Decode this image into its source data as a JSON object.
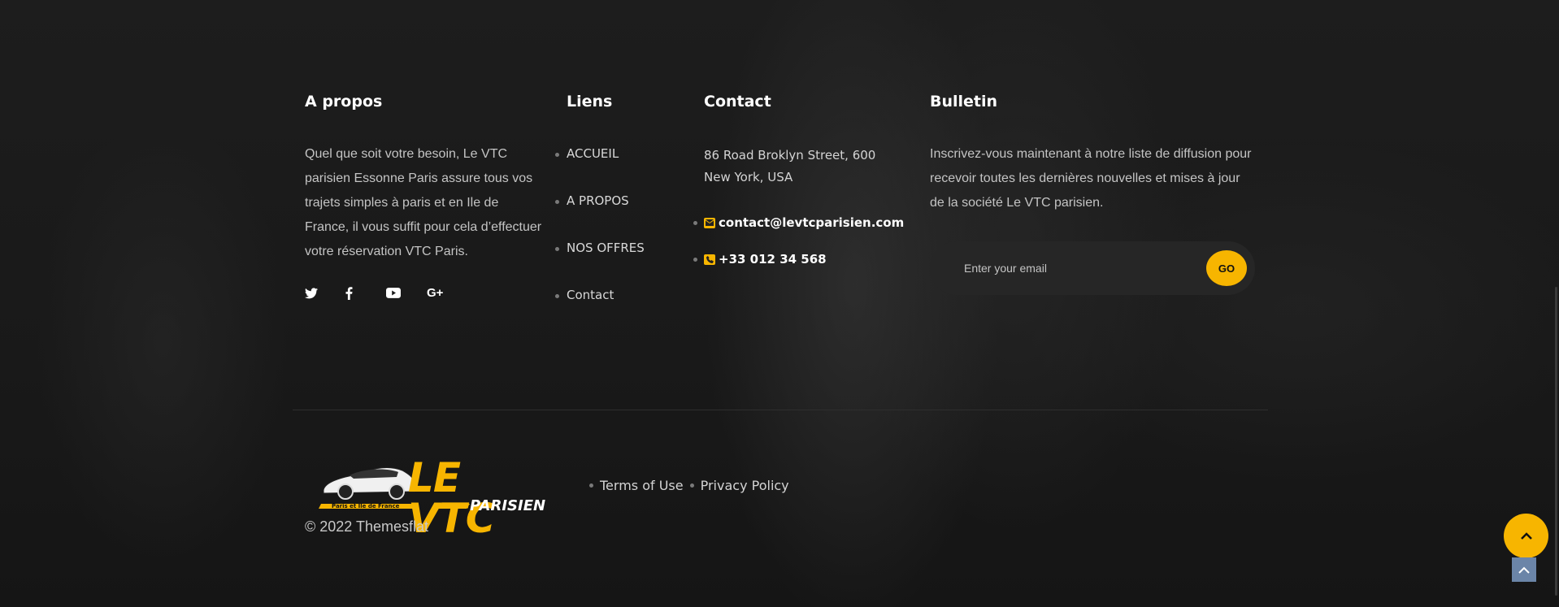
{
  "about": {
    "heading": "A propos",
    "text": "Quel que soit votre besoin, Le VTC parisien Essonne Paris assure tous vos trajets simples à paris et en Ile de France, il vous suffit pour cela d’effectuer votre réservation VTC Paris.",
    "social": [
      "twitter-icon",
      "facebook-icon",
      "youtube-icon",
      "google-plus-icon"
    ]
  },
  "links": {
    "heading": "Liens",
    "items": [
      "ACCUEIL",
      "A PROPOS",
      "NOS OFFRES",
      "Contact"
    ]
  },
  "contact": {
    "heading": "Contact",
    "address_line1": "86 Road Broklyn Street, 600",
    "address_line2": "New York, USA",
    "email": "contact@levtcparisien.com",
    "phone": "+33 012 34 568"
  },
  "bulletin": {
    "heading": "Bulletin",
    "text": "Inscrivez-vous maintenant à notre liste de diffusion pour recevoir toutes les dernières nouvelles et mises à jour de la société Le VTC parisien.",
    "email_placeholder": "Enter your email",
    "go_label": "GO"
  },
  "footer": {
    "logo_title": "LE VTC",
    "logo_subtitle": "PARISIEN",
    "logo_tagline": "Paris et Ile de France",
    "copyright": "© 2022 Themesflat",
    "terms": "Terms of Use",
    "privacy": "Privacy Policy"
  },
  "colors": {
    "accent": "#f7b500",
    "background": "#1a1a1a"
  }
}
